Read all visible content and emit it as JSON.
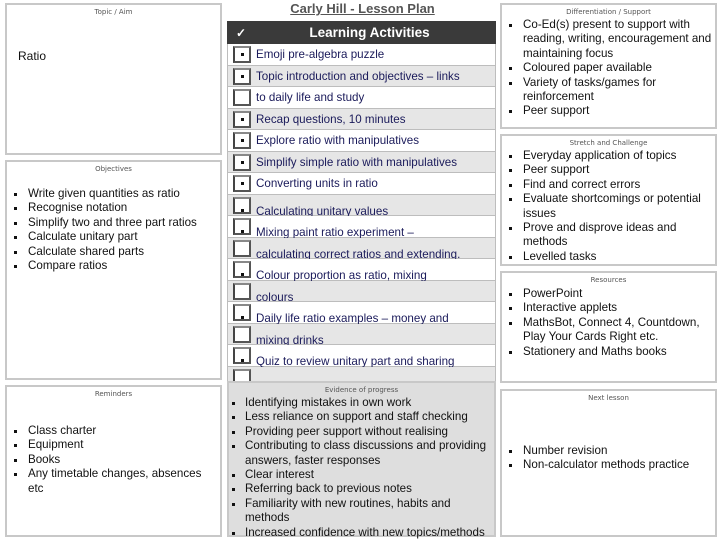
{
  "document_title": "Carly Hill - Lesson Plan",
  "topic": {
    "title": "Topic / Aim",
    "text": "Ratio"
  },
  "objectives": {
    "title": "Objectives",
    "items": [
      "Write given quantities as ratio",
      "Recognise notation",
      "Simplify two and three part ratios",
      "Calculate unitary part",
      "Calculate shared parts",
      "Compare ratios"
    ]
  },
  "reminders": {
    "title": "Reminders",
    "items": [
      "Class charter",
      "Equipment",
      "Books",
      "Any timetable changes, absences etc"
    ]
  },
  "learning_activities": {
    "check_header": "✓",
    "title": "Learning Activities",
    "rows": [
      {
        "text": "Emoji pre-algebra puzzle",
        "bullet": true
      },
      {
        "text": "Topic introduction and objectives – links",
        "bullet": true
      },
      {
        "text": "to daily life and study",
        "bullet": false
      },
      {
        "text": "Recap questions, 10 minutes",
        "bullet": true
      },
      {
        "text": "Explore ratio with manipulatives",
        "bullet": true
      },
      {
        "text": "Simplify simple ratio with manipulatives",
        "bullet": true
      },
      {
        "text": "Converting units in ratio",
        "bullet": true
      },
      {
        "text": "Calculating unitary values",
        "bullet": true
      },
      {
        "text": "Mixing paint ratio experiment –",
        "bullet": true
      },
      {
        "text": "calculating correct ratios and extending.",
        "bullet": false
      },
      {
        "text": "Colour proportion as ratio, mixing",
        "bullet": true
      },
      {
        "text": "colours",
        "bullet": false
      },
      {
        "text": "Daily life ratio examples – money and",
        "bullet": true
      },
      {
        "text": "mixing drinks",
        "bullet": false
      },
      {
        "text": "Quiz to review unitary part and sharing",
        "bullet": true
      },
      {
        "text": "",
        "bullet": false
      }
    ]
  },
  "evidence": {
    "title": "Evidence of progress",
    "items": [
      "Identifying mistakes in own work",
      "Less reliance on support and staff checking",
      "Providing peer support without realising",
      "Contributing to class discussions and providing answers, faster responses",
      "Clear interest",
      "Referring back to previous notes",
      "Familiarity with new routines, habits and methods",
      "Increased confidence with new topics/methods"
    ]
  },
  "differentiation": {
    "title": "Differentiation / Support",
    "items": [
      "Co-Ed(s) present to support with reading, writing, encouragement and maintaining focus",
      "Coloured paper available",
      "Variety of tasks/games for reinforcement",
      "Peer support"
    ]
  },
  "stretch": {
    "title": "Stretch and Challenge",
    "items": [
      "Everyday application of topics",
      "Peer support",
      "Find and correct errors",
      "Evaluate shortcomings or potential issues",
      "Prove and disprove ideas and methods",
      "Levelled tasks"
    ]
  },
  "resources": {
    "title": "Resources",
    "items": [
      "PowerPoint",
      "Interactive applets",
      "MathsBot, Connect 4, Countdown, Play Your Cards Right etc.",
      "Stationery and Maths books"
    ]
  },
  "next_lesson": {
    "title": "Next lesson",
    "items": [
      "Number revision",
      "Non-calculator methods practice"
    ]
  }
}
